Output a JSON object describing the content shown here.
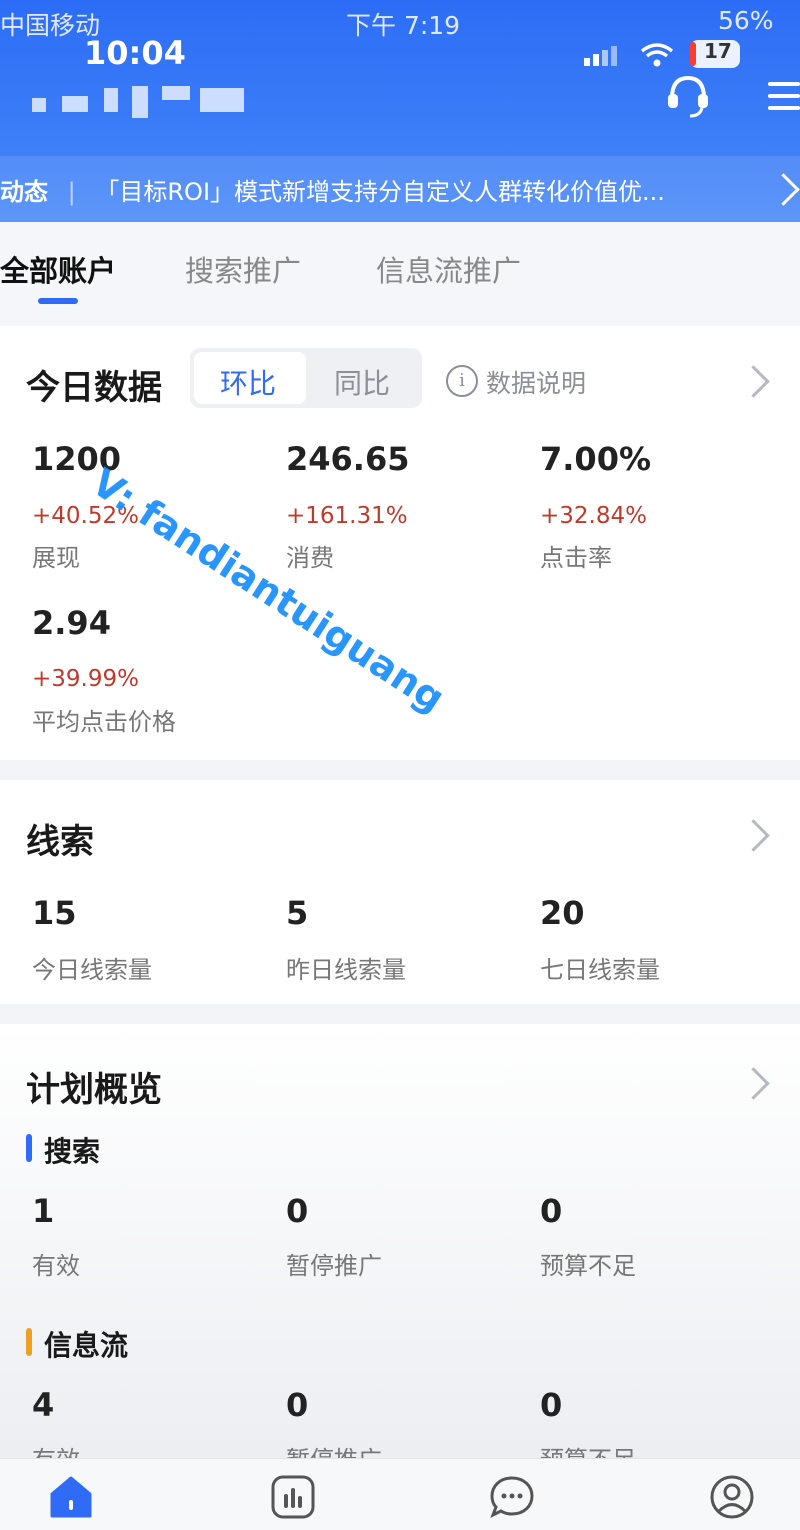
{
  "status_bar": {
    "carrier": "中国移动",
    "ghost_time": "下午 7:19",
    "ghost_battery": "56%",
    "time": "10:04",
    "notification_count": "17"
  },
  "news": {
    "label": "动态",
    "text": "「目标ROI」模式新增支持分自定义人群转化价值优..."
  },
  "tabs": [
    "全部账户",
    "搜索推广",
    "信息流推广"
  ],
  "today": {
    "title": "今日数据",
    "compare_tabs": [
      "环比",
      "同比"
    ],
    "info_label": "数据说明",
    "metrics": [
      {
        "value": "1200",
        "change": "+40.52%",
        "label": "展现"
      },
      {
        "value": "246.65",
        "change": "+161.31%",
        "label": "消费"
      },
      {
        "value": "7.00%",
        "change": "+32.84%",
        "label": "点击率"
      },
      {
        "value": "2.94",
        "change": "+39.99%",
        "label": "平均点击价格"
      }
    ]
  },
  "watermark": "V: fandiantuiguang",
  "leads": {
    "title": "线索",
    "metrics": [
      {
        "value": "15",
        "label": "今日线索量"
      },
      {
        "value": "5",
        "label": "昨日线索量"
      },
      {
        "value": "20",
        "label": "七日线索量"
      }
    ]
  },
  "plan": {
    "title": "计划概览",
    "groups": [
      {
        "name": "搜索",
        "color": "#2f6bf5",
        "metrics": [
          {
            "value": "1",
            "label": "有效"
          },
          {
            "value": "0",
            "label": "暂停推广"
          },
          {
            "value": "0",
            "label": "预算不足"
          }
        ]
      },
      {
        "name": "信息流",
        "color": "#f0a020",
        "metrics": [
          {
            "value": "4",
            "label": "有效"
          },
          {
            "value": "0",
            "label": "暂停推广"
          },
          {
            "value": "0",
            "label": "预算不足"
          }
        ]
      }
    ]
  },
  "bottom_nav": {
    "icons": [
      "home-icon",
      "report-icon",
      "message-icon",
      "profile-icon"
    ],
    "active_color": "#2f6bf5"
  }
}
